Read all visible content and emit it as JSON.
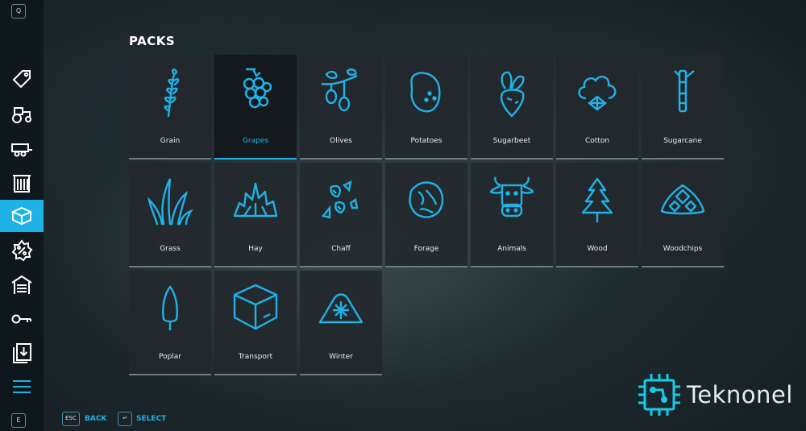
{
  "header": {
    "title": "PACKS"
  },
  "sidebar": {
    "top_key": "Q",
    "bottom_key": "E",
    "items": [
      {
        "icon": "price-tag-icon"
      },
      {
        "icon": "tractor-icon"
      },
      {
        "icon": "trailer-icon"
      },
      {
        "icon": "building-icon"
      },
      {
        "icon": "box-packs-icon",
        "active": true
      },
      {
        "icon": "sale-percent-icon"
      },
      {
        "icon": "garage-icon"
      },
      {
        "icon": "key-icon"
      },
      {
        "icon": "download-icon"
      },
      {
        "icon": "menu-icon"
      }
    ]
  },
  "packs": [
    {
      "label": "Grain",
      "icon": "grain-icon"
    },
    {
      "label": "Grapes",
      "icon": "grapes-icon",
      "selected": true
    },
    {
      "label": "Olives",
      "icon": "olives-icon"
    },
    {
      "label": "Potatoes",
      "icon": "potatoes-icon"
    },
    {
      "label": "Sugarbeet",
      "icon": "sugarbeet-icon"
    },
    {
      "label": "Cotton",
      "icon": "cotton-icon"
    },
    {
      "label": "Sugarcane",
      "icon": "sugarcane-icon"
    },
    {
      "label": "Grass",
      "icon": "grass-icon"
    },
    {
      "label": "Hay",
      "icon": "hay-icon"
    },
    {
      "label": "Chaff",
      "icon": "chaff-icon"
    },
    {
      "label": "Forage",
      "icon": "forage-icon"
    },
    {
      "label": "Animals",
      "icon": "animals-icon"
    },
    {
      "label": "Wood",
      "icon": "wood-icon"
    },
    {
      "label": "Woodchips",
      "icon": "woodchips-icon"
    },
    {
      "label": "Poplar",
      "icon": "poplar-icon"
    },
    {
      "label": "Transport",
      "icon": "transport-icon"
    },
    {
      "label": "Winter",
      "icon": "winter-icon"
    }
  ],
  "footer": {
    "back_key": "ESC",
    "back_label": "BACK",
    "select_key": "↵",
    "select_label": "SELECT"
  },
  "brand": {
    "name": "Teknonel"
  },
  "colors": {
    "accent": "#1fb2e6",
    "card": "#22282c",
    "text": "#ffffff"
  }
}
